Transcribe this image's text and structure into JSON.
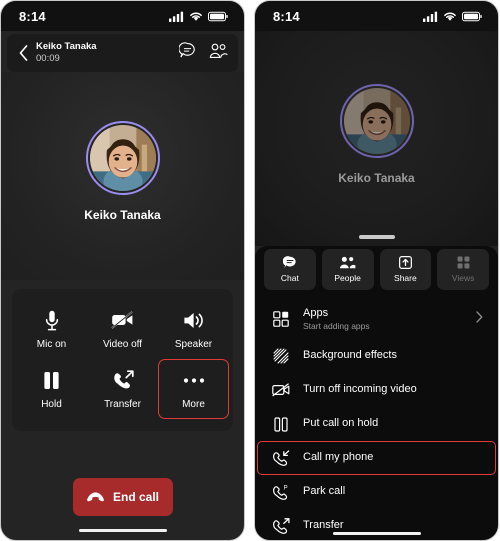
{
  "status_bar": {
    "time": "8:14",
    "icons": [
      "signal-icon",
      "wifi-icon",
      "battery-icon"
    ]
  },
  "left_phone": {
    "header": {
      "back_icon": "chevron-left-icon",
      "contact_name": "Keiko Tanaka",
      "call_duration": "00:09",
      "chat_icon": "chat-bubble-icon",
      "people_icon": "people-icon"
    },
    "stage": {
      "avatar_name": "Keiko Tanaka",
      "avatar_ring_color": "#9a8df0"
    },
    "controls": [
      {
        "label": "Mic on",
        "icon": "microphone-icon",
        "highlighted": false
      },
      {
        "label": "Video off",
        "icon": "video-off-icon",
        "highlighted": false
      },
      {
        "label": "Speaker",
        "icon": "speaker-icon",
        "highlighted": false
      },
      {
        "label": "Hold",
        "icon": "pause-icon",
        "highlighted": false
      },
      {
        "label": "Transfer",
        "icon": "phone-transfer-icon",
        "highlighted": false
      },
      {
        "label": "More",
        "icon": "ellipsis-icon",
        "highlighted": true
      }
    ],
    "end_call": {
      "label": "End call",
      "icon": "phone-hangup-icon",
      "color": "#a72b2b"
    }
  },
  "right_phone": {
    "stage": {
      "avatar_name": "Keiko Tanaka"
    },
    "sheet": {
      "quick_tabs": [
        {
          "label": "Chat",
          "icon": "chat-bubble-icon",
          "disabled": false
        },
        {
          "label": "People",
          "icon": "people-icon",
          "disabled": false
        },
        {
          "label": "Share",
          "icon": "share-upload-icon",
          "disabled": false
        },
        {
          "label": "Views",
          "icon": "grid-views-icon",
          "disabled": true
        }
      ],
      "menu_items": [
        {
          "label": "Apps",
          "sublabel": "Start adding apps",
          "icon": "apps-icon",
          "chevron": true,
          "highlighted": false
        },
        {
          "label": "Background effects",
          "sublabel": "",
          "icon": "background-effects-icon",
          "chevron": false,
          "highlighted": false
        },
        {
          "label": "Turn off incoming video",
          "sublabel": "",
          "icon": "video-off-icon",
          "chevron": false,
          "highlighted": false
        },
        {
          "label": "Put call on hold",
          "sublabel": "",
          "icon": "pause-icon",
          "chevron": false,
          "highlighted": false
        },
        {
          "label": "Call my phone",
          "sublabel": "",
          "icon": "phone-incoming-icon",
          "chevron": false,
          "highlighted": true
        },
        {
          "label": "Park call",
          "sublabel": "",
          "icon": "phone-park-icon",
          "chevron": false,
          "highlighted": false
        },
        {
          "label": "Transfer",
          "sublabel": "",
          "icon": "phone-transfer-icon",
          "chevron": false,
          "highlighted": false
        }
      ]
    }
  },
  "accent_colors": {
    "annotation_red": "#e23b35",
    "end_call_red": "#a72b2b",
    "avatar_ring": "#9a8df0"
  }
}
